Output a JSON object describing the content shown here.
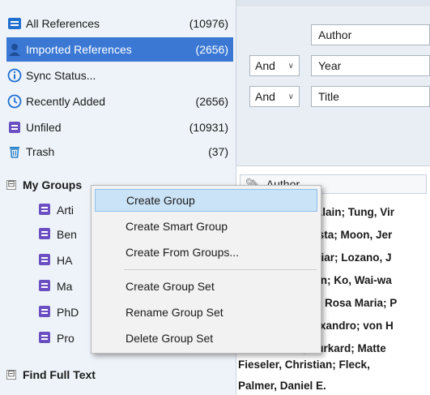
{
  "colors": {
    "accent": "#3a78d4",
    "group_icon": "#6a4fc2",
    "library_icon_blue": "#1f6fd1"
  },
  "library": {
    "items": [
      {
        "label": "All References",
        "count": "(10976)",
        "icon": "book-stack-icon"
      },
      {
        "label": "Imported References",
        "count": "(2656)",
        "icon": "person-icon",
        "selected": true
      },
      {
        "label": "Sync Status...",
        "count": "",
        "icon": "info-icon"
      },
      {
        "label": "Recently Added",
        "count": "(2656)",
        "icon": "clock-icon"
      },
      {
        "label": "Unfiled",
        "count": "(10931)",
        "icon": "unfiled-book-icon"
      },
      {
        "label": "Trash",
        "count": "(37)",
        "icon": "trash-icon"
      }
    ]
  },
  "groups": {
    "header": "My Groups",
    "expander": "⊟",
    "items": [
      {
        "label": "Arti"
      },
      {
        "label": "Ben"
      },
      {
        "label": "HA"
      },
      {
        "label": "Ma"
      },
      {
        "label": "PhD"
      },
      {
        "label": "Pro"
      }
    ]
  },
  "find_full_text": {
    "header": "Find Full Text",
    "expander": "⊟"
  },
  "search": {
    "rows": [
      {
        "operator": "",
        "field": "Author"
      },
      {
        "operator": "And",
        "field": "Year"
      },
      {
        "operator": "And",
        "field": "Title"
      }
    ]
  },
  "results": {
    "column_header": "Author",
    "authors": [
      "e, Alain; Tung, Vir",
      "Krista; Moon, Jer",
      ", Itziar; Lozano, J",
      "rdon; Ko, Wai-wa",
      "ico, Rosa Maria; P",
      "Alexandro; von H",
      ", Burkard; Matte",
      "Fieseler, Christian; Fleck,",
      "Palmer, Daniel E."
    ]
  },
  "context_menu": {
    "items": [
      {
        "label": "Create Group",
        "hover": true
      },
      {
        "label": "Create Smart Group"
      },
      {
        "label": "Create From Groups..."
      },
      {
        "label": "Create Group Set"
      },
      {
        "label": "Rename Group Set"
      },
      {
        "label": "Delete Group Set"
      }
    ]
  }
}
